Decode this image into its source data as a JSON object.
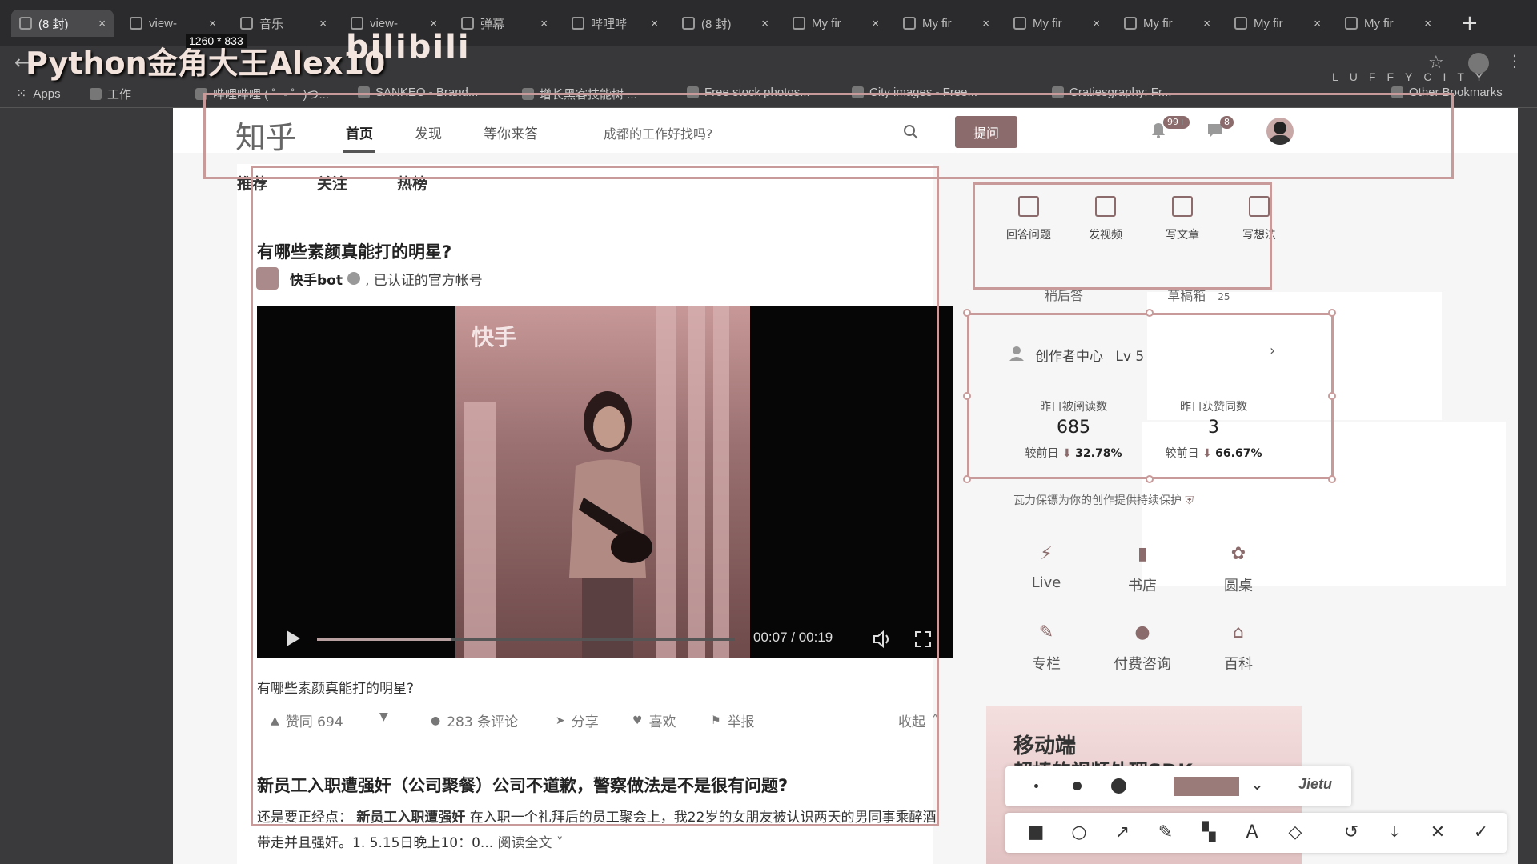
{
  "browser": {
    "tabs": [
      {
        "label": "(8 封)"
      },
      {
        "label": "view-"
      },
      {
        "label": "音乐"
      },
      {
        "label": "view-"
      },
      {
        "label": "弹幕"
      },
      {
        "label": "哔哩哔"
      },
      {
        "label": "(8 封)"
      },
      {
        "label": "My fir"
      },
      {
        "label": "My fir"
      },
      {
        "label": "My fir"
      },
      {
        "label": "My fir"
      },
      {
        "label": "My fir"
      },
      {
        "label": "My fir"
      }
    ],
    "bookmarks": [
      {
        "label": "Apps"
      },
      {
        "label": "工作"
      },
      {
        "label": "哔哩哔哩 ( ゜- ゜)つ..."
      },
      {
        "label": "SANKEO - Brand..."
      },
      {
        "label": "增长黑客技能树 ..."
      },
      {
        "label": "Free stock photos..."
      },
      {
        "label": "City images - Free..."
      },
      {
        "label": "Cratiesgraphy: Fr..."
      },
      {
        "label": "Other Bookmarks"
      }
    ]
  },
  "overlay": {
    "title": "Python金角大王Alex10",
    "size_badge": "1260 * 833",
    "bili_logo": "bilibili",
    "luffy": "LUFFYCITY"
  },
  "header": {
    "logo": "知乎",
    "nav": [
      "首页",
      "发现",
      "等你来答"
    ],
    "search_placeholder": "成都的工作好找吗?",
    "ask_button": "提问",
    "notifications_badge": "99+",
    "messages_badge": "8"
  },
  "feed": {
    "tabs": [
      "推荐",
      "关注",
      "热榜"
    ],
    "item1": {
      "title": "有哪些素颜真能打的明星?",
      "author": "快手bot",
      "author_desc": ", 已认证的官方帐号",
      "video_watermark": "快手",
      "video_time": "00:07 / 00:19",
      "video_progress": 0.32,
      "subtitle": "有哪些素颜真能打的明星?",
      "actions": {
        "upvote": "赞同 694",
        "comments": "283 条评论",
        "share": "分享",
        "like": "喜欢",
        "report": "举报",
        "collapse": "收起"
      }
    },
    "item2": {
      "title": "新员工入职遭强奸（公司聚餐）公司不道歉，警察做法是不是很有问题?",
      "excerpt_lead": "还是要正经点：",
      "excerpt_bold": "新员工入职遭强奸",
      "excerpt_rest": " 在入职一个礼拜后的员工聚会上，我22岁的女朋友被认识两天的男同事乘醉酒带走并且强奸。1. 5.15日晚上10：0...",
      "read_more": "阅读全文"
    }
  },
  "sidebar": {
    "create": [
      "回答问题",
      "发视频",
      "写文章",
      "写想法"
    ],
    "later_answer": "稍后答",
    "drafts": "草稿箱",
    "drafts_count": "25",
    "creator": {
      "title": "创作者中心",
      "level": "Lv 5",
      "reads_label": "昨日被阅读数",
      "reads_value": "685",
      "reads_change_label": "较前日",
      "reads_change": "32.78%",
      "likes_label": "昨日获赞同数",
      "likes_value": "3",
      "likes_change_label": "较前日",
      "likes_change": "66.67%"
    },
    "protect_note": "瓦力保镖为你的创作提供持续保护",
    "services": [
      {
        "label": "Live",
        "icon": "lightning-icon"
      },
      {
        "label": "书店",
        "icon": "book-icon"
      },
      {
        "label": "圆桌",
        "icon": "flower-icon"
      },
      {
        "label": "专栏",
        "icon": "pen-icon"
      },
      {
        "label": "付费咨询",
        "icon": "consult-icon"
      },
      {
        "label": "百科",
        "icon": "encyclopedia-icon"
      }
    ],
    "mobile_banner_title": "移动端",
    "mobile_banner_sub": "超棒的视频处理SDK"
  },
  "screenshot_tool": {
    "label": "Jietu"
  },
  "colors": {
    "accent": "#8b6b6b",
    "frame": "#c99a9a"
  }
}
